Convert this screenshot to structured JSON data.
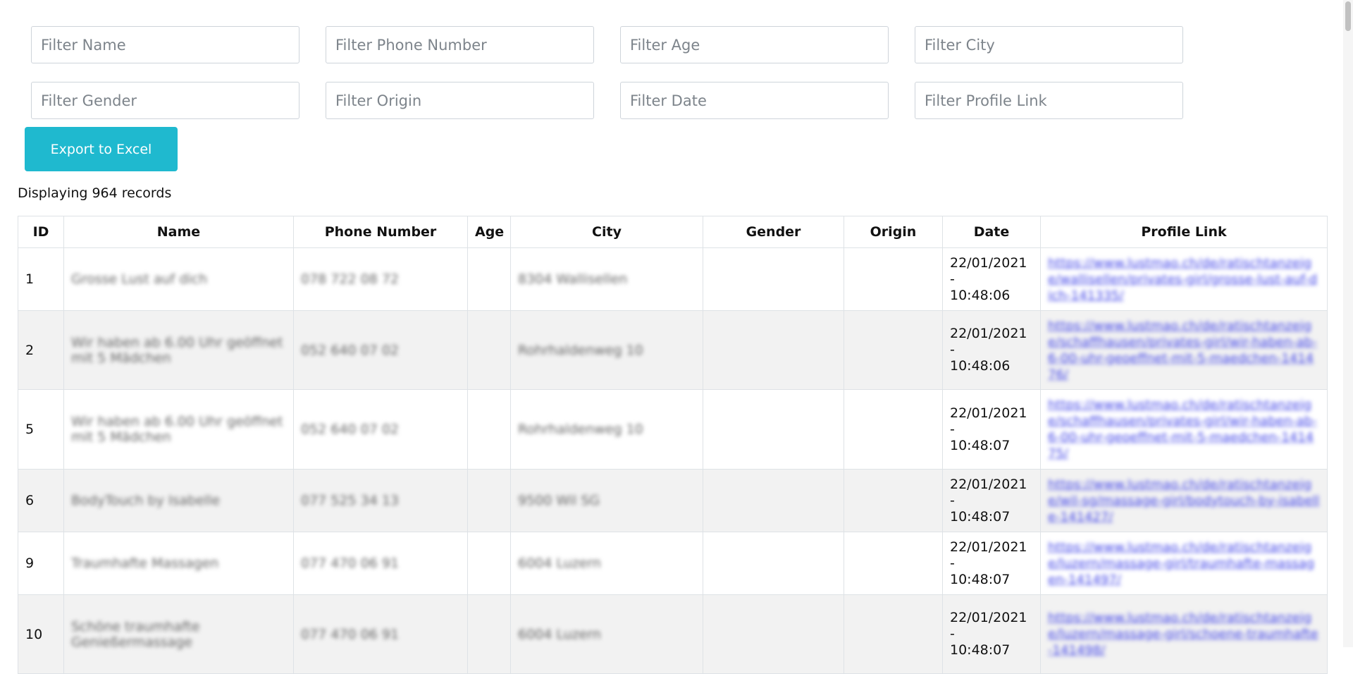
{
  "filters": {
    "name": "Filter Name",
    "phone": "Filter Phone Number",
    "age": "Filter Age",
    "city": "Filter City",
    "gender": "Filter Gender",
    "origin": "Filter Origin",
    "date": "Filter Date",
    "profile_link": "Filter Profile Link"
  },
  "export_label": "Export to Excel",
  "count_text": "Displaying 964 records",
  "columns": [
    "ID",
    "Name",
    "Phone Number",
    "Age",
    "City",
    "Gender",
    "Origin",
    "Date",
    "Profile Link"
  ],
  "rows": [
    {
      "id": "1",
      "name": "Grosse Lust auf dich",
      "phone": "078 722 08 72",
      "age": "",
      "city": "8304 Wallisellen",
      "gender": "",
      "origin": "",
      "date_line1": "22/01/2021 -",
      "date_line2": "10:48:06",
      "link": "https://www.lustmao.ch/de/ratischtanzeige/wallisellen/privates-girl/grosse-lust-auf-dich-141335/"
    },
    {
      "id": "2",
      "name": "Wir haben ab 6.00 Uhr geöffnet mit 5 Mädchen",
      "phone": "052 640 07 02",
      "age": "",
      "city": "Rohrhaldenweg 10",
      "gender": "",
      "origin": "",
      "date_line1": "22/01/2021 -",
      "date_line2": "10:48:06",
      "link": "https://www.lustmao.ch/de/ratischtanzeige/schaffhausen/privates-girl/wir-haben-ab-6-00-uhr-geoeffnet-mit-5-maedchen-141476/"
    },
    {
      "id": "5",
      "name": "Wir haben ab 6.00 Uhr geöffnet mit 5 Mädchen",
      "phone": "052 640 07 02",
      "age": "",
      "city": "Rohrhaldenweg 10",
      "gender": "",
      "origin": "",
      "date_line1": "22/01/2021 -",
      "date_line2": "10:48:07",
      "link": "https://www.lustmao.ch/de/ratischtanzeige/schaffhausen/privates-girl/wir-haben-ab-6-00-uhr-geoeffnet-mit-5-maedchen-141475/"
    },
    {
      "id": "6",
      "name": "BodyTouch by Isabelle",
      "phone": "077 525 34 13",
      "age": "",
      "city": "9500 Wil SG",
      "gender": "",
      "origin": "",
      "date_line1": "22/01/2021 -",
      "date_line2": "10:48:07",
      "link": "https://www.lustmao.ch/de/ratischtanzeige/wil-sg/massage-girl/bodytouch-by-isabelle-141427/"
    },
    {
      "id": "9",
      "name": "Traumhafte Massagen",
      "phone": "077 470 06 91",
      "age": "",
      "city": "6004 Luzern",
      "gender": "",
      "origin": "",
      "date_line1": "22/01/2021 -",
      "date_line2": "10:48:07",
      "link": "https://www.lustmao.ch/de/ratischtanzeige/luzern/massage-girl/traumhafte-massagen-141497/"
    },
    {
      "id": "10",
      "name": "Schöne traumhafte Genießermassage",
      "phone": "077 470 06 91",
      "age": "",
      "city": "6004 Luzern",
      "gender": "",
      "origin": "",
      "date_line1": "22/01/2021 -",
      "date_line2": "10:48:07",
      "link": "https://www.lustmao.ch/de/ratischtanzeige/luzern/massage-girl/schoene-traumhafte-141498/"
    }
  ]
}
